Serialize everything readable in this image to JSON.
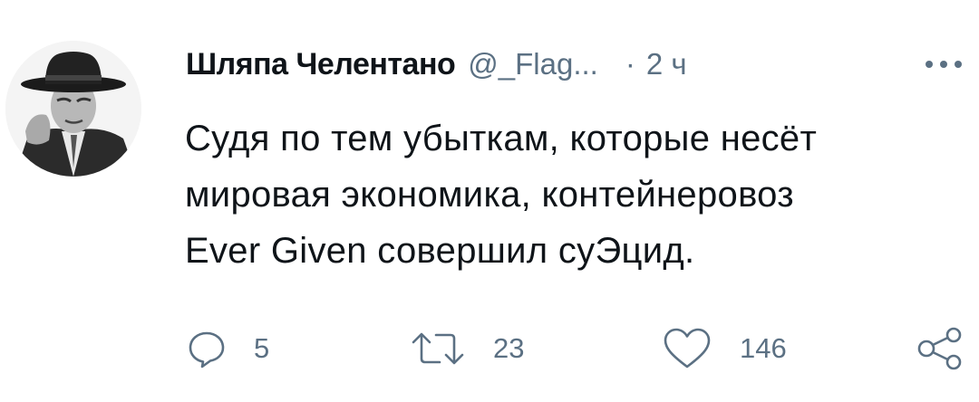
{
  "author": {
    "display_name": "Шляпа Челентано",
    "handle": "@_Flag...",
    "separator": "·",
    "time": "2 ч",
    "avatar_icon": "avatar-man-in-hat"
  },
  "tweet": {
    "lines": [
      "Судя по тем убыткам, которые несёт",
      "мировая экономика, контейнеровоз",
      "Ever Given совершил суЭцид."
    ]
  },
  "actions": {
    "reply": {
      "icon": "reply-bubble-icon",
      "count": "5"
    },
    "retweet": {
      "icon": "retweet-icon",
      "count": "23"
    },
    "like": {
      "icon": "heart-icon",
      "count": "146"
    },
    "share": {
      "icon": "share-nodes-icon"
    }
  },
  "colors": {
    "text": "#0f1419",
    "secondary": "#5b7083",
    "background": "#ffffff"
  }
}
